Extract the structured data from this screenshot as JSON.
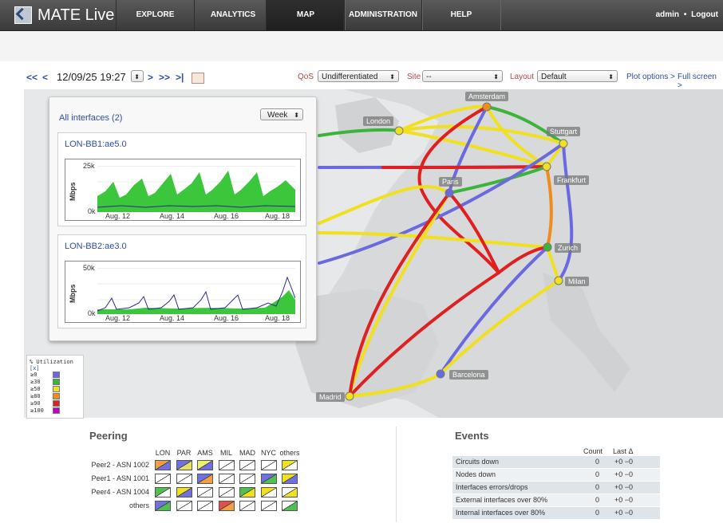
{
  "app": {
    "name": "MATE Live"
  },
  "nav": {
    "tabs": [
      {
        "label": "EXPLORE"
      },
      {
        "label": "ANALYTICS"
      },
      {
        "label": "MAP"
      },
      {
        "label": "ADMINISTRATION"
      },
      {
        "label": "HELP"
      }
    ],
    "active_tab": "MAP",
    "user": "admin",
    "separator": "•",
    "logout": "Logout"
  },
  "toolbar": {
    "first": "<<",
    "prev": "<",
    "datetime": "12/09/25 19:27",
    "next": ">",
    "next_fast": ">>",
    "last": ">|",
    "qos_label": "QoS",
    "qos_value": "Undifferentiated",
    "site_label": "Site",
    "site_value": "--",
    "layout_label": "Layout",
    "layout_value": "Default",
    "plot_options": "Plot options >",
    "full_screen": "Full screen >"
  },
  "map": {
    "cities": [
      {
        "name": "Amsterdam"
      },
      {
        "name": "London"
      },
      {
        "name": "Stuttgart"
      },
      {
        "name": "Frankfurt"
      },
      {
        "name": "Paris"
      },
      {
        "name": "Zurich"
      },
      {
        "name": "Milan"
      },
      {
        "name": "Barcelona"
      },
      {
        "name": "Madrid"
      }
    ]
  },
  "interfaces": {
    "title": "All interfaces (2)",
    "range": "Week",
    "items": [
      {
        "name": "LON-BB1:ae5.0",
        "ymax": "25k",
        "ymin": "0k",
        "ytitle": "Mbps",
        "xticks": [
          "Aug. 12",
          "Aug. 14",
          "Aug. 16",
          "Aug. 18"
        ]
      },
      {
        "name": "LON-BB2:ae3.0",
        "ymax": "50k",
        "ymin": "0k",
        "ytitle": "Mbps",
        "xticks": [
          "Aug. 12",
          "Aug. 14",
          "Aug. 16",
          "Aug. 18"
        ]
      }
    ]
  },
  "legend": {
    "title": "% Utilization",
    "close": "[x]",
    "rows": [
      {
        "label": "≥0",
        "color": "#6a6ae0"
      },
      {
        "label": "≥30",
        "color": "#3cb43c"
      },
      {
        "label": "≥50",
        "color": "#f0e020"
      },
      {
        "label": "≥80",
        "color": "#f08c1e"
      },
      {
        "label": "≥90",
        "color": "#e02020"
      },
      {
        "label": "≥100",
        "color": "#c000c0"
      }
    ]
  },
  "peering": {
    "title": "Peering",
    "columns": [
      "LON",
      "PAR",
      "AMS",
      "MIL",
      "MAD",
      "NYC",
      "others"
    ],
    "rows": [
      {
        "label": "Peer2 - ASN 1002",
        "cells": [
          [
            "#f0a040",
            "#7070e0"
          ],
          [
            "#7070e0",
            "#e8e060"
          ],
          [
            "#f0f070",
            "#7070e0"
          ],
          [
            "#fff",
            "#fff"
          ],
          [
            "#fff",
            "#fff"
          ],
          [
            "#fff",
            "#fff"
          ],
          [
            "#f0e020",
            "#fff"
          ]
        ]
      },
      {
        "label": "Peer1 - ASN 1001",
        "cells": [
          [
            "#fff",
            "#fff"
          ],
          [
            "#fff",
            "#fff"
          ],
          [
            "#7070e0",
            "#f0a040"
          ],
          [
            "#fff",
            "#fff"
          ],
          [
            "#fff",
            "#fff"
          ],
          [
            "#7070e0",
            "#50c050"
          ],
          [
            "#f0e020",
            "#7070e0"
          ]
        ]
      },
      {
        "label": "Peer4 - ASN 1004",
        "cells": [
          [
            "#50c050",
            "#fff"
          ],
          [
            "#f0e020",
            "#7070e0"
          ],
          [
            "#fff",
            "#fff"
          ],
          [
            "#fff",
            "#fff"
          ],
          [
            "#50c050",
            "#f0e020"
          ],
          [
            "#f0e020",
            "#fff"
          ],
          [
            "#fff",
            "#f0e020"
          ]
        ]
      },
      {
        "label": "others",
        "cells": [
          [
            "#7070e0",
            "#50c050"
          ],
          [
            "#fff",
            "#fff"
          ],
          [
            "#fff",
            "#fff"
          ],
          [
            "#e05050",
            "#f0a040"
          ],
          [
            "#fff",
            "#fff"
          ],
          [
            "#fff",
            "#fff"
          ],
          [
            "#fff",
            "#50c050"
          ]
        ]
      }
    ]
  },
  "events": {
    "title": "Events",
    "col_count": "Count",
    "col_last": "Last Δ",
    "rows": [
      {
        "label": "Circuits down",
        "count": "0",
        "last": "+0 −0"
      },
      {
        "label": "Nodes down",
        "count": "0",
        "last": "+0 −0"
      },
      {
        "label": "Interfaces errors/drops",
        "count": "0",
        "last": "+0 −0"
      },
      {
        "label": "External interfaces over 80%",
        "count": "0",
        "last": "+0 −0"
      },
      {
        "label": "Internal interfaces over 80%",
        "count": "0",
        "last": "+0 −0"
      }
    ]
  }
}
